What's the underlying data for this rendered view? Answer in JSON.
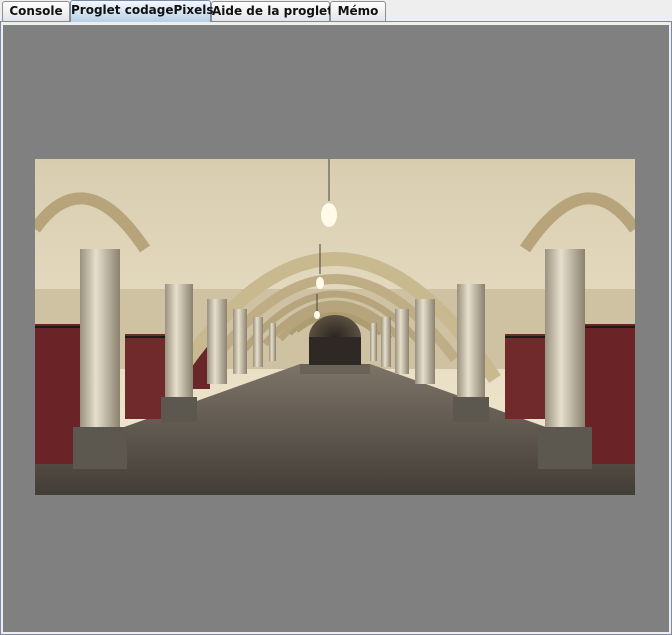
{
  "tabs": [
    {
      "label": "Console",
      "selected": false
    },
    {
      "label": "Proglet codagePixels",
      "selected": true
    },
    {
      "label": "Aide de la proglet",
      "selected": false
    },
    {
      "label": "Mémo",
      "selected": false
    }
  ],
  "canvas": {
    "background": "#808080",
    "image_subject": "arched stable hallway with columns"
  }
}
